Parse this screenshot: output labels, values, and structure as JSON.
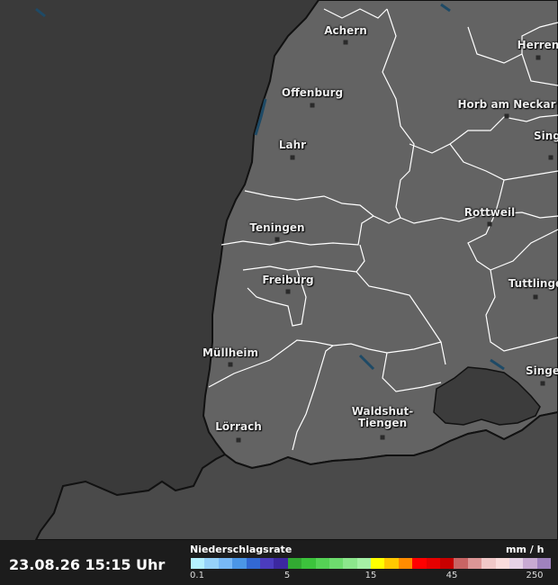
{
  "timestamp": "23.08.26 15:15 Uhr",
  "legend": {
    "title": "Niederschlagsrate",
    "unit": "mm / h",
    "colors": [
      "#b4f0ff",
      "#96d2fa",
      "#78b9f5",
      "#4b96e6",
      "#3268d2",
      "#4b3cbe",
      "#3c28a0",
      "#32aa32",
      "#3cc33c",
      "#55d255",
      "#6edc6e",
      "#8ce68c",
      "#a5f0a5",
      "#ffff00",
      "#ffc800",
      "#ff8c00",
      "#ff0000",
      "#e60000",
      "#c80000",
      "#c86464",
      "#dc9696",
      "#f0c8c8",
      "#fadcdc",
      "#e6d2e6",
      "#c8aad2",
      "#a082be"
    ],
    "ticks": [
      "0.1",
      "5",
      "15",
      "45",
      "250"
    ]
  },
  "cities": [
    {
      "name": "Achern"
    },
    {
      "name": "Herren"
    },
    {
      "name": "Offenburg"
    },
    {
      "name": "Horb am Neckar"
    },
    {
      "name": "Lahr"
    },
    {
      "name": "Singe"
    },
    {
      "name": "Teningen"
    },
    {
      "name": "Rottweil"
    },
    {
      "name": "Freiburg"
    },
    {
      "name": "Tuttlinge"
    },
    {
      "name": "Müllheim"
    },
    {
      "name": "Singe"
    },
    {
      "name": "Waldshut-\nTiengen"
    },
    {
      "name": "Lörrach"
    }
  ],
  "colors": {
    "outside": "#3a3a3a",
    "region": "#636363",
    "switzerland": "#4a4a4a",
    "border": "#111111",
    "district": "#ffffff",
    "water": "#1e4a66"
  }
}
